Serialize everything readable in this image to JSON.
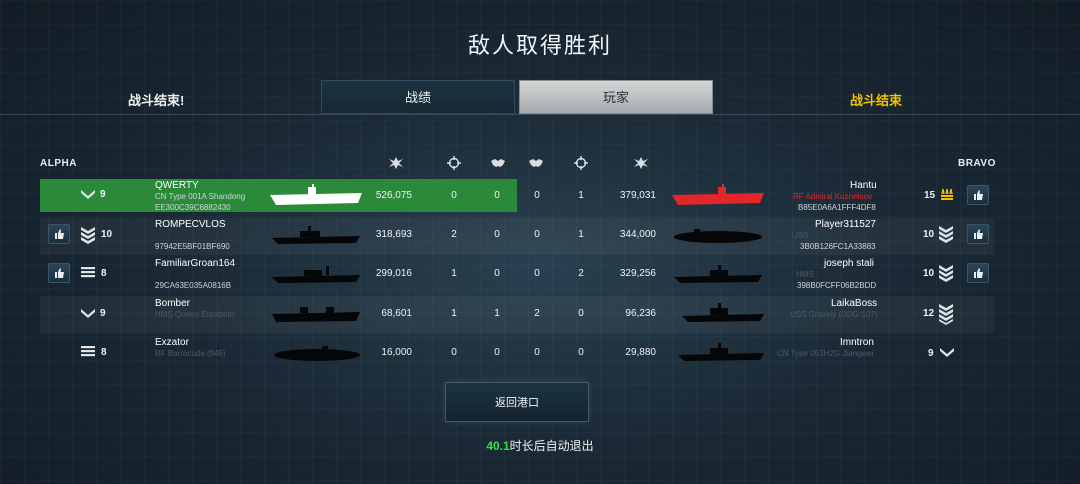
{
  "title": "敌人取得胜利",
  "header": {
    "left_status": "战斗结束!",
    "right_status": "战斗结束",
    "tabs": [
      {
        "label": "战绩",
        "active": false
      },
      {
        "label": "玩家",
        "active": true
      }
    ]
  },
  "teams": {
    "left": "ALPHA",
    "right": "BRAVO"
  },
  "colors": {
    "highlight": "#2a8a3a",
    "enemy_highlight": "#e2262a",
    "countdown": "#2ee24a",
    "status_gold": "#f2c200"
  },
  "alpha": [
    {
      "level": "9",
      "name": "QWERTY",
      "ship": "CN Type 001A Shandong",
      "id": "EE300C39C6882430",
      "damage": "526,075",
      "kills": "0",
      "assists": "0",
      "is_self": true
    },
    {
      "level": "10",
      "name": "ROMPECVLOS",
      "ship": "",
      "id": "97942E5BF01BF690",
      "damage": "318,693",
      "kills": "2",
      "assists": "0"
    },
    {
      "level": "8",
      "name": "FamiliarGroan164",
      "ship": "",
      "id": "29CA63E035A0816B",
      "damage": "299,016",
      "kills": "1",
      "assists": "0"
    },
    {
      "level": "9",
      "name": "Bomber",
      "ship": "HMS Queen Elizabeth",
      "id": "",
      "damage": "68,601",
      "kills": "1",
      "assists": "1"
    },
    {
      "level": "8",
      "name": "Exzator",
      "ship": "RF Barracuda (945)",
      "id": "",
      "damage": "16,000",
      "kills": "0",
      "assists": "0"
    }
  ],
  "bravo": [
    {
      "level": "15",
      "name": "Hantu",
      "ship": "RF Admiral Kuznetsov",
      "id": "B85E0A6A1FFF4DF8",
      "damage": "379,031",
      "kills": "1",
      "assists": "0"
    },
    {
      "level": "10",
      "name": "Player311527",
      "ship": "USS",
      "id": "3B0B126FC1A33883",
      "damage": "344,000",
      "kills": "1",
      "assists": "0"
    },
    {
      "level": "10",
      "name": "joseph stali",
      "ship": "HMS",
      "id": "398B0FCFF06B2BDD",
      "damage": "329,256",
      "kills": "2",
      "assists": "0"
    },
    {
      "level": "12",
      "name": "LaikaBoss",
      "ship": "USS Gravely (DDG-107)",
      "id": "",
      "damage": "96,236",
      "kills": "0",
      "assists": "2"
    },
    {
      "level": "9",
      "name": "Imntron",
      "ship": "CN Type 053H2G Jiangwei",
      "id": "",
      "damage": "29,880",
      "kills": "0",
      "assists": "0"
    }
  ],
  "icons": [
    "damage-icon",
    "crosshair-icon",
    "handshake-icon",
    "thumbs-up-icon",
    "rank-chevron-icon",
    "rank-bars-icon"
  ],
  "footer": {
    "return_label": "返回港口",
    "countdown": "40.1",
    "exit_text": "时长后自动退出"
  }
}
